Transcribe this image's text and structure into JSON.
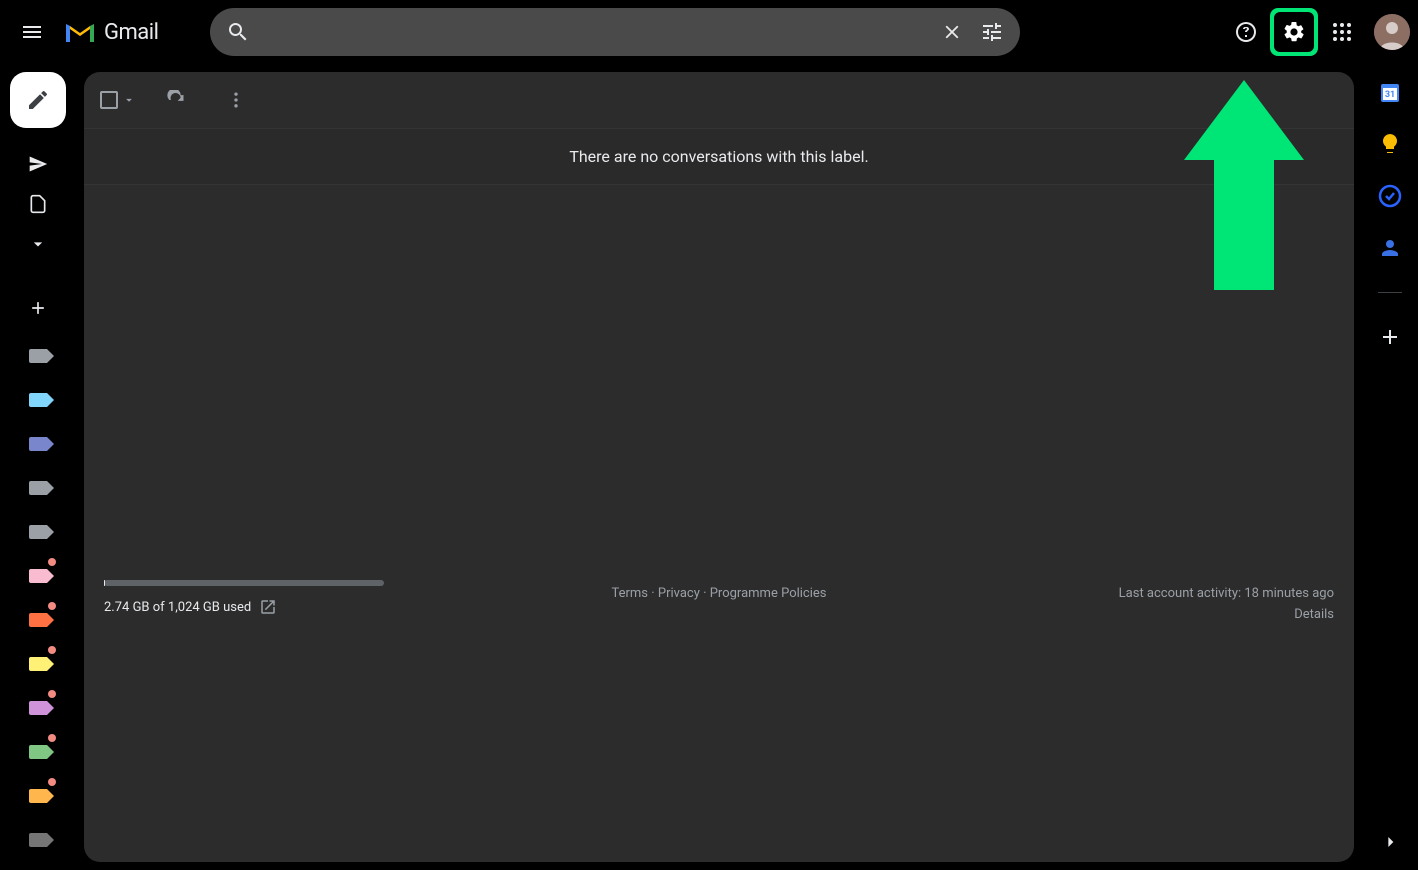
{
  "header": {
    "app_name": "Gmail",
    "search_placeholder": "",
    "search_value": ""
  },
  "sidebar": {
    "compose_label": "Compose",
    "nav_items": [
      {
        "name": "sent",
        "icon": "send"
      },
      {
        "name": "drafts",
        "icon": "file"
      },
      {
        "name": "more",
        "icon": "chevron-down"
      }
    ],
    "labels": [
      {
        "color": "#9aa0a6",
        "has_badge": false
      },
      {
        "color": "#81d4fa",
        "has_badge": false
      },
      {
        "color": "#7986cb",
        "has_badge": false
      },
      {
        "color": "#9aa0a6",
        "has_badge": false
      },
      {
        "color": "#9aa0a6",
        "has_badge": false
      },
      {
        "color": "#f8bbd0",
        "has_badge": true
      },
      {
        "color": "#ff7043",
        "has_badge": true
      },
      {
        "color": "#fff176",
        "has_badge": true
      },
      {
        "color": "#ce93d8",
        "has_badge": true
      },
      {
        "color": "#81c784",
        "has_badge": true
      },
      {
        "color": "#ffb74d",
        "has_badge": true
      },
      {
        "color": "#757575",
        "has_badge": false
      }
    ]
  },
  "main": {
    "empty_message": "There are no conversations with this label."
  },
  "footer": {
    "storage_text": "2.74 GB of 1,024 GB used",
    "links": {
      "terms": "Terms",
      "privacy": "Privacy",
      "policies": "Programme Policies"
    },
    "separator": " · ",
    "activity_text": "Last account activity: 18 minutes ago",
    "details_link": "Details"
  },
  "right_rail": {
    "apps": [
      {
        "name": "calendar",
        "color": "#4285f4"
      },
      {
        "name": "keep",
        "color": "#fbbc04"
      },
      {
        "name": "tasks",
        "color": "#1a73e8"
      },
      {
        "name": "contacts",
        "color": "#1a73e8"
      }
    ]
  },
  "colors": {
    "highlight": "#00e676",
    "bg_panel": "#2c2c2c",
    "bg_search": "#4a4a4a"
  }
}
